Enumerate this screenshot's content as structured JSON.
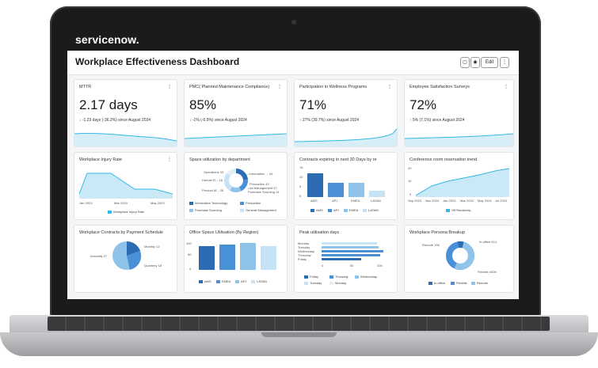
{
  "brand": "servicenow.",
  "dashboard_title": "Workplace Effectiveness Dashboard",
  "toolbar": {
    "edit_label": "Edit",
    "more_label": "⋮"
  },
  "kpis": [
    {
      "title": "MTTR",
      "value": "2.17 days",
      "delta": "↓ -1.23 days (-36.2%) since August 2024"
    },
    {
      "title": "PMC( Planned Maintenance Compliance)",
      "value": "85%",
      "delta": "↓ -1% (-0.9%) since August 2024"
    },
    {
      "title": "Participation in Wellness Programs",
      "value": "71%",
      "delta": "↑ 27% (39.7%) since August 2024"
    },
    {
      "title": "Employee Satisfaction Surveys",
      "value": "72%",
      "delta": "↑ 5% (7.1%) since August 2024"
    }
  ],
  "injury": {
    "title": "Workplace Injury Rate",
    "x_labels": [
      "Jan 2023",
      "Mar 2023",
      "May 2023"
    ],
    "legend": "Workplace Injury Rate"
  },
  "space": {
    "title": "Space utilization by department",
    "labels": [
      "Operations 33",
      "Human R... 18",
      "Product M... 28",
      "...Information ... 44",
      "Production 42",
      "...rial Management 47",
      "Purchase Sourcing 14"
    ],
    "legend": [
      "Information Technology",
      "Production",
      "Purchase Sourcing",
      "General Management"
    ]
  },
  "contracts": {
    "title": "Contracts expiring in next 30 Days by re",
    "y_ticks": [
      "0",
      "5",
      "10",
      "15"
    ],
    "categories": [
      "AMS",
      "APJ",
      "EMEA",
      "LATAM"
    ],
    "legend": [
      "AMS",
      "APJ",
      "EMEA",
      "LATAM"
    ]
  },
  "conference": {
    "title": "Conference room reservation trend",
    "y_ticks": [
      "0",
      "10",
      "20"
    ],
    "x_labels": [
      "Sep 2023",
      "Nov 2023",
      "Jan 2024",
      "Mar 2024",
      "May 2024",
      "Jul 2024"
    ],
    "legend": "Off Randomly"
  },
  "payment": {
    "title": "Workplace Contracts by Payment Schedule",
    "labels": [
      "Monthly 12",
      "Annually 27",
      "Quarterly 18"
    ]
  },
  "office": {
    "title": "Office Space Utilisation (By Region)",
    "y_ticks": [
      "0",
      "50",
      "100"
    ],
    "legend": [
      "AMS",
      "EMEA",
      "APJ",
      "LATAM"
    ]
  },
  "peak": {
    "title": "Peak utilisation days",
    "days": [
      "Monday",
      "Tuesday",
      "Wednesday",
      "Thursday",
      "Friday"
    ],
    "x_ticks": [
      "0",
      "50",
      "100"
    ],
    "legend": [
      "Friday",
      "Thursday",
      "Wednesday",
      "Tuesday",
      "Monday"
    ]
  },
  "persona": {
    "title": "Workplace Persona Breakup",
    "labels": [
      "Remote 196",
      "In-office 414",
      "Flexible 4000"
    ],
    "legend": [
      "In-office",
      "Flexible",
      "Remote"
    ]
  },
  "colors": {
    "dark_blue": "#2b6cb3",
    "mid_blue": "#4a90d6",
    "light_blue": "#8fc3ea",
    "pale_blue": "#c6e2f5",
    "teal_line": "#33b8e4"
  }
}
